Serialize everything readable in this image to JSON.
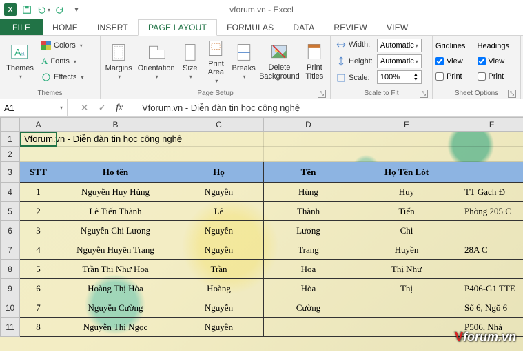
{
  "app": {
    "title": "vforum.vn - Excel"
  },
  "qat": {
    "save": "Save",
    "undo": "Undo",
    "redo": "Redo"
  },
  "tabs": [
    "FILE",
    "HOME",
    "INSERT",
    "PAGE LAYOUT",
    "FORMULAS",
    "DATA",
    "REVIEW",
    "VIEW"
  ],
  "active_tab": "PAGE LAYOUT",
  "ribbon": {
    "themes": {
      "label": "Themes",
      "themes_btn": "Themes",
      "colors": "Colors",
      "fonts": "Fonts",
      "effects": "Effects"
    },
    "page_setup": {
      "label": "Page Setup",
      "margins": "Margins",
      "orientation": "Orientation",
      "size": "Size",
      "print_area": "Print\nArea",
      "breaks": "Breaks",
      "background": "Delete\nBackground",
      "print_titles": "Print\nTitles"
    },
    "scale": {
      "label": "Scale to Fit",
      "width_lbl": "Width:",
      "height_lbl": "Height:",
      "scale_lbl": "Scale:",
      "width_val": "Automatic",
      "height_val": "Automatic",
      "scale_val": "100%"
    },
    "sheet_options": {
      "label": "Sheet Options",
      "gridlines": "Gridlines",
      "headings": "Headings",
      "view": "View",
      "print": "Print",
      "gridlines_view": true,
      "gridlines_print": false,
      "headings_view": true,
      "headings_print": false
    }
  },
  "formula_bar": {
    "cell_ref": "A1",
    "formula": "Vforum.vn - Diễn đàn tin học công nghệ"
  },
  "sheet": {
    "columns": [
      "A",
      "B",
      "C",
      "D",
      "E",
      "F"
    ],
    "row1_text": "Vforum.vn - Diễn đàn tin học công nghệ",
    "headers": {
      "stt": "STT",
      "hoten": "Ho tên",
      "ho": "Họ",
      "ten": "Tên",
      "hotenlot": "Họ Tên Lót",
      "addr": ""
    },
    "rows": [
      {
        "n": 4,
        "stt": "1",
        "hoten": "Nguyễn Huy Hùng",
        "ho": "Nguyễn",
        "ten": "Hùng",
        "lot": "Huy",
        "addr": "TT Gạch Đ"
      },
      {
        "n": 5,
        "stt": "2",
        "hoten": "Lê Tiến Thành",
        "ho": "Lê",
        "ten": "Thành",
        "lot": "Tiến",
        "addr": "Phòng 205 C"
      },
      {
        "n": 6,
        "stt": "3",
        "hoten": "Nguyễn Chi Lương",
        "ho": "Nguyễn",
        "ten": "Lương",
        "lot": "Chi",
        "addr": ""
      },
      {
        "n": 7,
        "stt": "4",
        "hoten": "Nguyễn Huyền Trang",
        "ho": "Nguyễn",
        "ten": "Trang",
        "lot": "Huyền",
        "addr": "28A C"
      },
      {
        "n": 8,
        "stt": "5",
        "hoten": "Trần Thị Như Hoa",
        "ho": "Trần",
        "ten": "Hoa",
        "lot": "Thị Như",
        "addr": ""
      },
      {
        "n": 9,
        "stt": "6",
        "hoten": "Hoàng Thị Hòa",
        "ho": "Hoàng",
        "ten": "Hòa",
        "lot": "Thị",
        "addr": "P406-G1 TTE"
      },
      {
        "n": 10,
        "stt": "7",
        "hoten": "Nguyễn  Cường",
        "ho": "Nguyễn",
        "ten": "Cường",
        "lot": "",
        "addr": "Số 6, Ngõ 6"
      },
      {
        "n": 11,
        "stt": "8",
        "hoten": "Nguyễn Thị Ngọc",
        "ho": "Nguyễn",
        "ten": "",
        "lot": "",
        "addr": "P506, Nhà"
      }
    ]
  },
  "watermark": "Vforum.vn"
}
